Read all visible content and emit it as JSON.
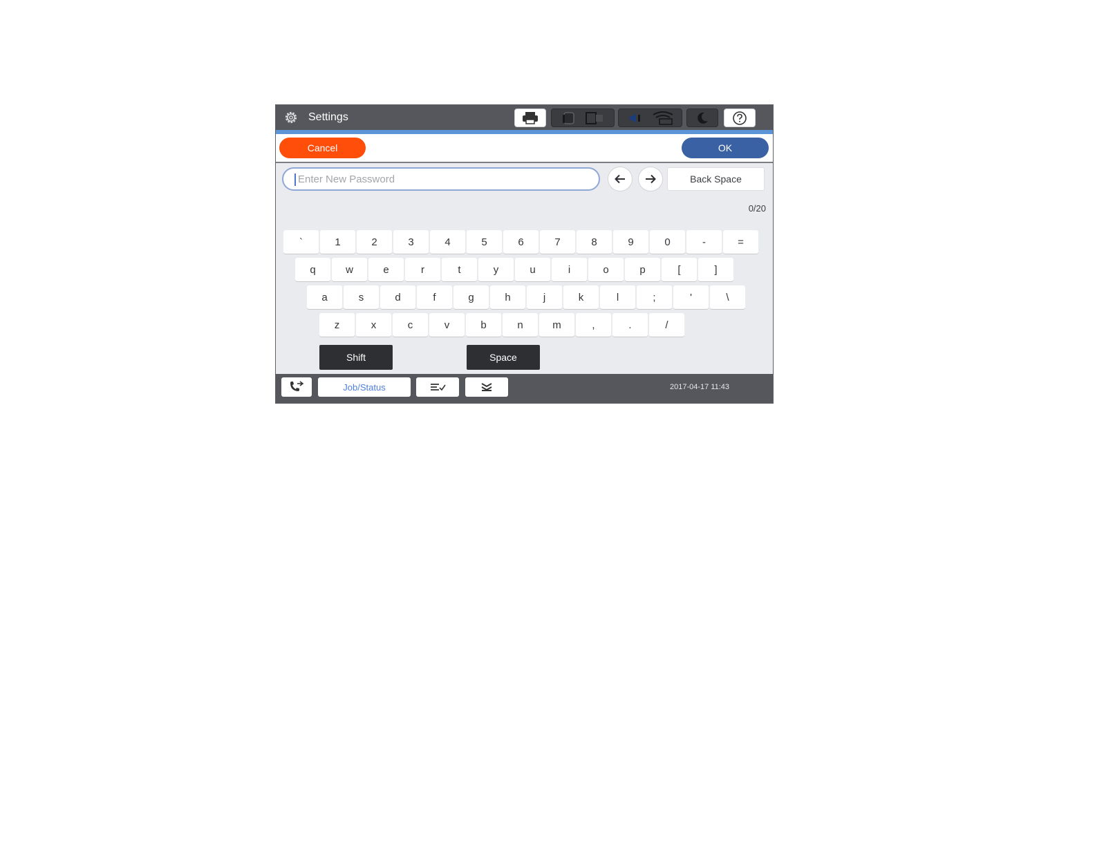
{
  "header": {
    "title": "Settings",
    "icons": [
      "printer-icon",
      "memory-card-icon",
      "wifi-direct-icon",
      "speaker-icon",
      "wifi-off-icon",
      "sleep-icon",
      "help-icon"
    ]
  },
  "actions": {
    "cancel_label": "Cancel",
    "ok_label": "OK"
  },
  "input": {
    "placeholder": "Enter New Password",
    "value": "",
    "back_space_label": "Back Space",
    "counter": "0/20"
  },
  "keyboard": {
    "row1": [
      "`",
      "1",
      "2",
      "3",
      "4",
      "5",
      "6",
      "7",
      "8",
      "9",
      "0",
      "-",
      "="
    ],
    "row2": [
      "q",
      "w",
      "e",
      "r",
      "t",
      "y",
      "u",
      "i",
      "o",
      "p",
      "[",
      "]"
    ],
    "row3": [
      "a",
      "s",
      "d",
      "f",
      "g",
      "h",
      "j",
      "k",
      "l",
      ";",
      "'",
      "\\"
    ],
    "row4": [
      "z",
      "x",
      "c",
      "v",
      "b",
      "n",
      "m",
      ",",
      ".",
      "/"
    ],
    "shift_label": "Shift",
    "space_label": "Space"
  },
  "footer": {
    "job_status_label": "Job/Status",
    "datetime": "2017-04-17 11:43"
  },
  "colors": {
    "cancel": "#ff4d0a",
    "ok": "#3a61a4",
    "header_bg": "#55575c",
    "accent_line": "#5b95d8",
    "job_status_text": "#4e7ee0"
  }
}
